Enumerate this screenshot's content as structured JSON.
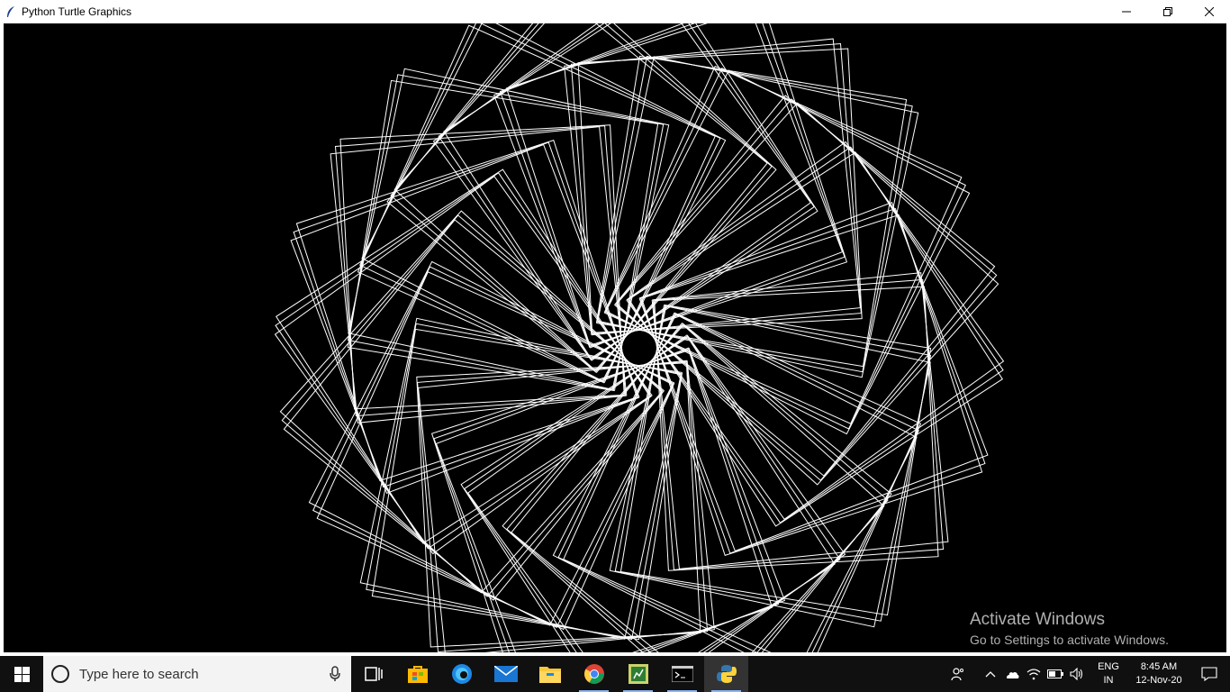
{
  "window": {
    "title": "Python Turtle Graphics",
    "controls": [
      "minimize-icon",
      "restore-icon",
      "close-icon"
    ]
  },
  "canvas": {
    "background": "#000000",
    "pen_color": "#ffffff",
    "drawing": "spirograph of repeated rotated squares"
  },
  "watermark": {
    "title": "Activate Windows",
    "subtitle": "Go to Settings to activate Windows."
  },
  "taskbar": {
    "search_placeholder": "Type here to search",
    "apps": [
      "task-view-icon",
      "store-icon",
      "edge-icon",
      "mail-icon",
      "file-explorer-icon",
      "chrome-icon",
      "spreadsheet-icon",
      "terminal-icon",
      "python-icon"
    ],
    "tray": {
      "language": "ENG",
      "region": "IN",
      "time": "8:45 AM",
      "date": "12-Nov-20"
    }
  }
}
